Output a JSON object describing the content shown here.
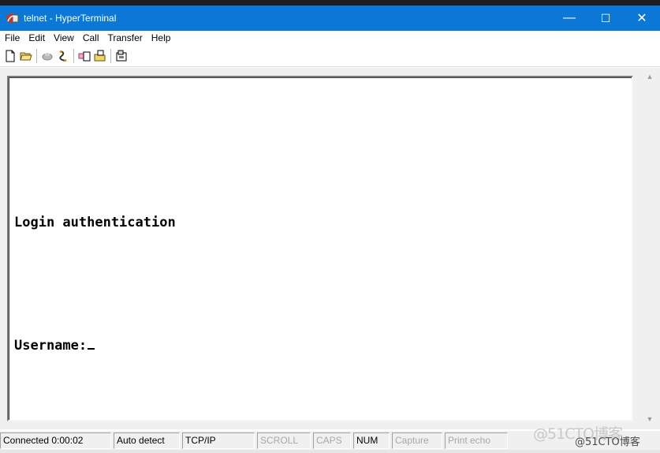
{
  "window": {
    "title": "telnet - HyperTerminal",
    "minimize": "—",
    "maximize": "☐",
    "close": "✕",
    "accent": "#0b78d7"
  },
  "menu": [
    "File",
    "Edit",
    "View",
    "Call",
    "Transfer",
    "Help"
  ],
  "toolbar": {
    "icons": [
      "new-document-icon",
      "open-folder-icon",
      "phone-icon",
      "disconnect-icon",
      "send-icon",
      "receive-icon",
      "properties-icon"
    ]
  },
  "terminal": {
    "lines": [
      "",
      "Login authentication",
      "",
      "Username:"
    ]
  },
  "status": {
    "connected": "Connected 0:00:02",
    "detect": "Auto detect",
    "protocol": "TCP/IP",
    "scroll": "SCROLL",
    "caps": "CAPS",
    "num": "NUM",
    "capture": "Capture",
    "print_echo": "Print echo"
  },
  "watermark": {
    "large": "@51CTO博客",
    "small": "@51CTO博客"
  }
}
